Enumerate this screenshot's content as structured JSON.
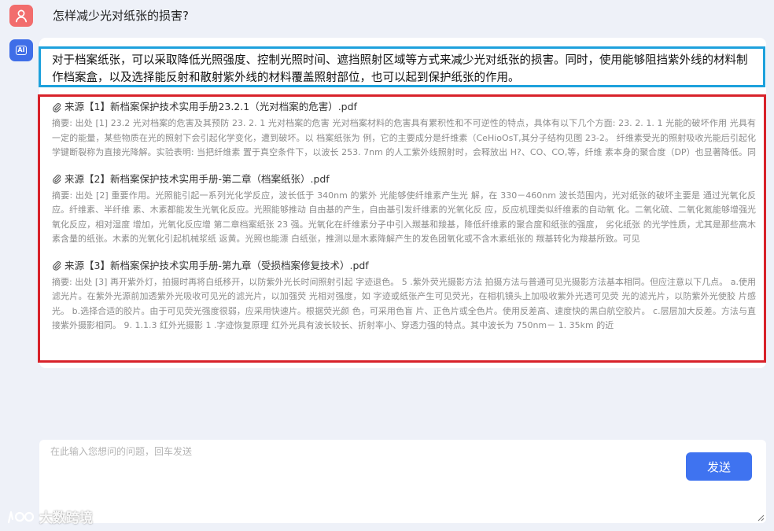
{
  "user": {
    "question": "怎样减少光对纸张的损害?"
  },
  "assistant": {
    "badge": "AI",
    "answer": "对于档案纸张，可以采取降低光照强度、控制光照时间、遮挡照射区域等方式来减少光对纸张的损害。同时，使用能够阻挡紫外线的材料制作档案盒，以及选择能反射和散射紫外线的材料覆盖照射部位，也可以起到保护纸张的作用。",
    "sources": [
      {
        "title": "来源【1】新档案保护技术实用手册23.2.1（光对档案的危害）.pdf",
        "excerpt": "摘要: 出处 [1] 23.2 光对档案的危害及其预防 23. 2. 1 光对档案的危害 光对档案材料的危害具有累积性和不可逆性的特点，具体有以下几个方面: 23. 2. 1. 1 光能的破坏作用 光具有一定的能量，某些物质在光的照射下会引起化学变化，遭到破坏。以 档案纸张为 例，它的主要成分是纤维素（CeHioOsT,其分子结构见图 23-2。 纤维素受光的照射吸收光能后引起化学键断裂称为直接光降解。实验表明: 当把纤维素 置于真空条件下，以波长 253. 7nm 的人工紫外线照射时，会释放出 H?、CO、CO,等，纤维 素本身的聚合度（DP）也显著降低。同时，如果把纤维 素置于惰性气体（Nz、C02, He）中， 纤维素破坏程度与在氧中的作用相似。 所以 253. 7nm 的紫外线对纤维素的直接光降解作用实"
      },
      {
        "title": "来源【2】新档案保护技术实用手册-第二章（档案纸张）.pdf",
        "excerpt": "摘要: 出处 [2] 重要作用。光照能引起一系列光化学反应，波长低于 340nm 的紫外 光能够使纤维素产生光 解，在 330－460nm 波长范围内，光对纸张的破坏主要是 通过光氧化反应。纤维素、半纤维 素、木素都能发生光氧化反应。光照能够推动 自由基的产生，自由基引发纤维素的光氧化反 应，反应机理类似纤维素的自动氧 化。二氧化硫、二氧化氮能够增强光氧化反应，相对湿度 增加，光氧化反应增 第二章档案纸张 23 强。光氧化在纤维素分子中引入羰基和羧基，降低纤维素的聚合度和纸张的强度， 劣化纸张 的光学性质，尤其是那些高木素含量的纸张。木素的光氧化引起机械浆纸 返黄。光照也能漂 白纸张，推测以是木素降解产生的发色团氧化或不含木素纸张的 羰基转化为羧基所致。可见"
      },
      {
        "title": "来源【3】新档案保护技术实用手册-第九章（受损档案修复技术）.pdf",
        "excerpt": "摘要: 出处 [3] 再开紫外灯，拍摄时再将白纸移开，以防紫外光长时间照射引起 字迹退色。 5 .紫外荧光摄影方法 拍摄方法与普通可见光摄影方法基本相同。但应注意以下几点。 a.使用滤光片。在紫外光源前加透紫外光吸收可见光的滤光片，以加强荧 光相对强度，如 字迹或纸张产生可见荧光，在相机镜头上加吸收紫外光透可见荧 光的滤光片，以防紫外光使胶 片感光。 b.选择合适的胶片。由于可见荧光强度很弱，应采用快速片。根据荧光颜 色，可采用色盲 片、正色片或全色片。使用反差高、速度快的黑白航空胶片。 c.层层加大反差。方法与直接紫外摄影相同。 9. 1.1.3 红外光摄影 1 .字迹恢复原理 红外光具有波长较长、折射率小、穿透力强的特点。其中波长为 750nm－ 1. 35km 的近"
      }
    ]
  },
  "composer": {
    "placeholder": "在此输入您想问的问题，回车发送",
    "value": "",
    "send_label": "发送"
  },
  "watermark": {
    "text": "大数跨境"
  },
  "colors": {
    "background": "#eef1f8",
    "user_avatar": "#f26d6d",
    "ai_avatar": "#3f6ee8",
    "answer_highlight": "#1da1dc",
    "sources_highlight": "#d8222a",
    "send_button": "#3f73f0"
  },
  "icons": {
    "user_avatar": "user-icon",
    "ai_avatar": "ai-badge-icon",
    "source_attachment": "paperclip-icon",
    "resize": "resize-grip-icon",
    "watermark_logo": "brand-logo-icon"
  }
}
